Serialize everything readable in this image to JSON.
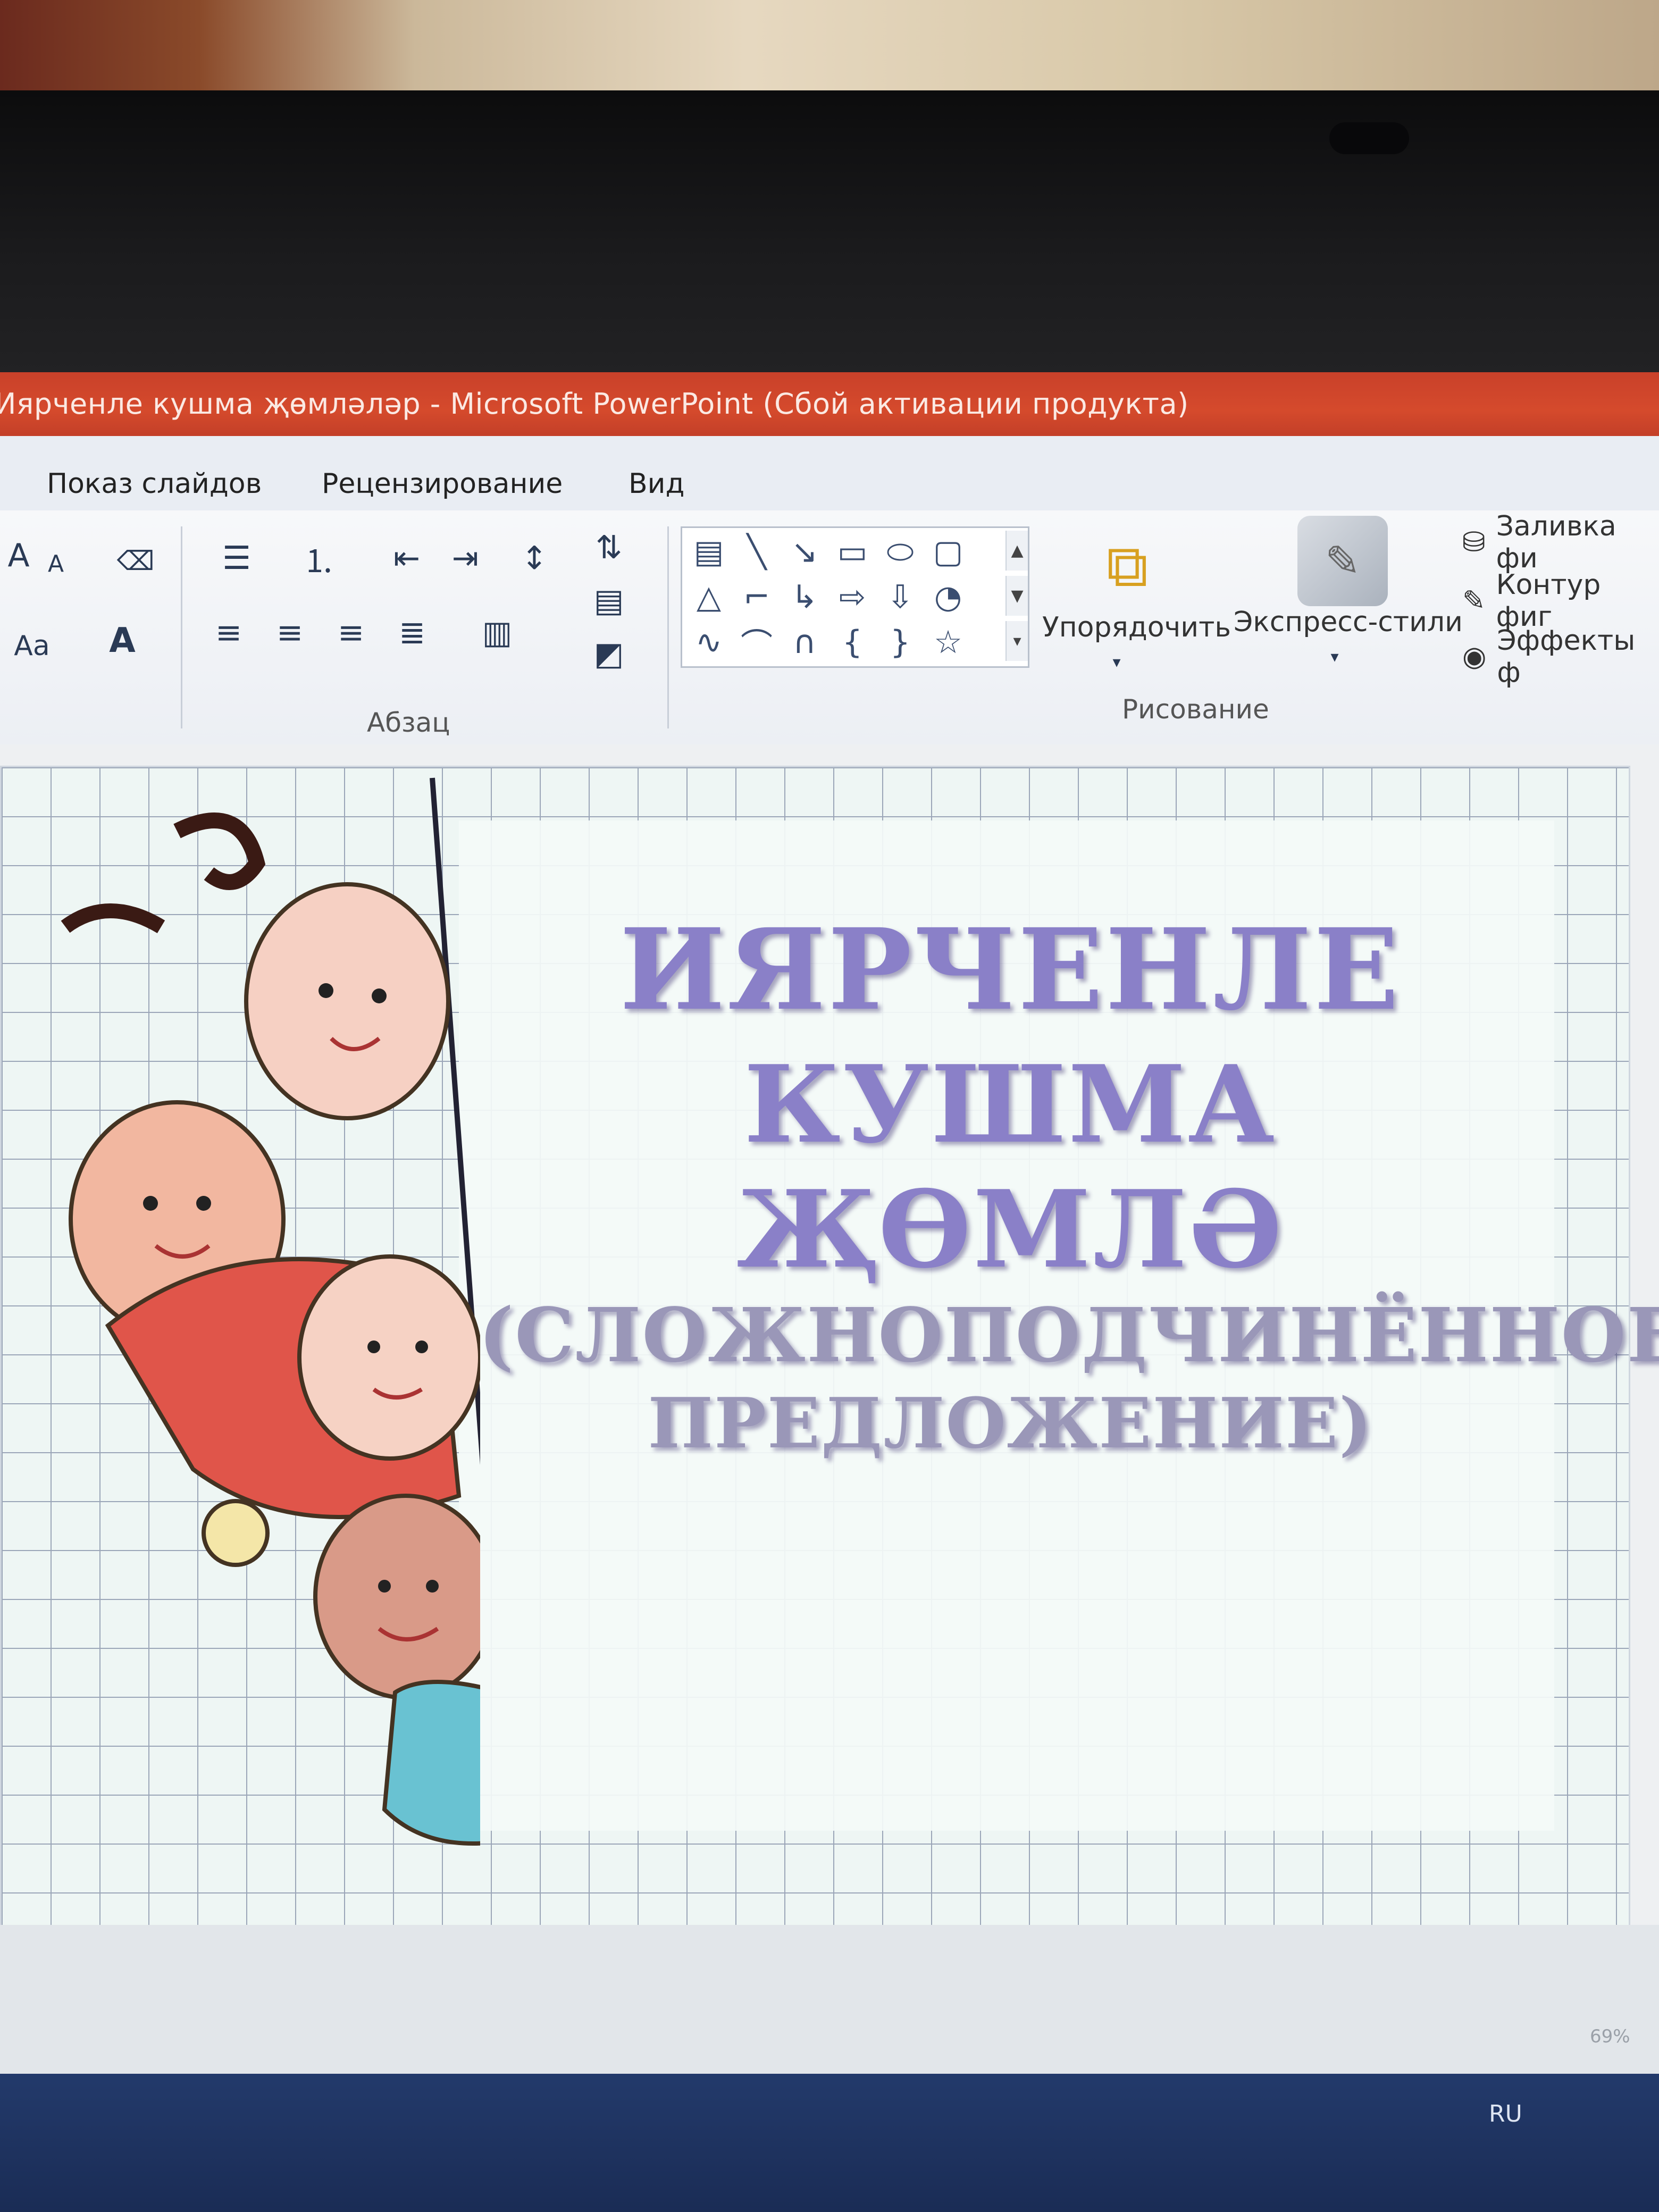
{
  "window": {
    "title": "Иярченле кушма җөмләләр - Microsoft PowerPoint (Сбой активации продукта)"
  },
  "tabs": [
    {
      "label": "Показ слайдов"
    },
    {
      "label": "Рецензирование"
    },
    {
      "label": "Вид"
    }
  ],
  "ribbon": {
    "paragraph_group_label": "Абзац",
    "drawing_group_label": "Рисование",
    "arrange_label": "Упорядочить",
    "quick_styles_label": "Экспресс-стили",
    "shape_fill_label": "Заливка фи",
    "shape_outline_label": "Контур фиг",
    "shape_effects_label": "Эффекты ф",
    "font_size_inc": "A",
    "font_size_dec": "A",
    "change_case": "Aa",
    "font_color": "A"
  },
  "slide": {
    "title_line1": "ИЯРЧЕНЛЕ",
    "title_line2": "КУШМА ҖӨМЛӘ",
    "subtitle_line1": "(СЛОЖНОПОДЧИНЁННОЕ",
    "subtitle_line2": "ПРЕДЛОЖЕНИЕ)"
  },
  "status": {
    "zoom": "69%"
  },
  "taskbar": {
    "language": "RU"
  },
  "colors": {
    "titlebar": "#d54a2c",
    "title_text": "#8a80c8",
    "subtitle_text": "#9a97b8",
    "taskbar": "#1a2c55"
  }
}
